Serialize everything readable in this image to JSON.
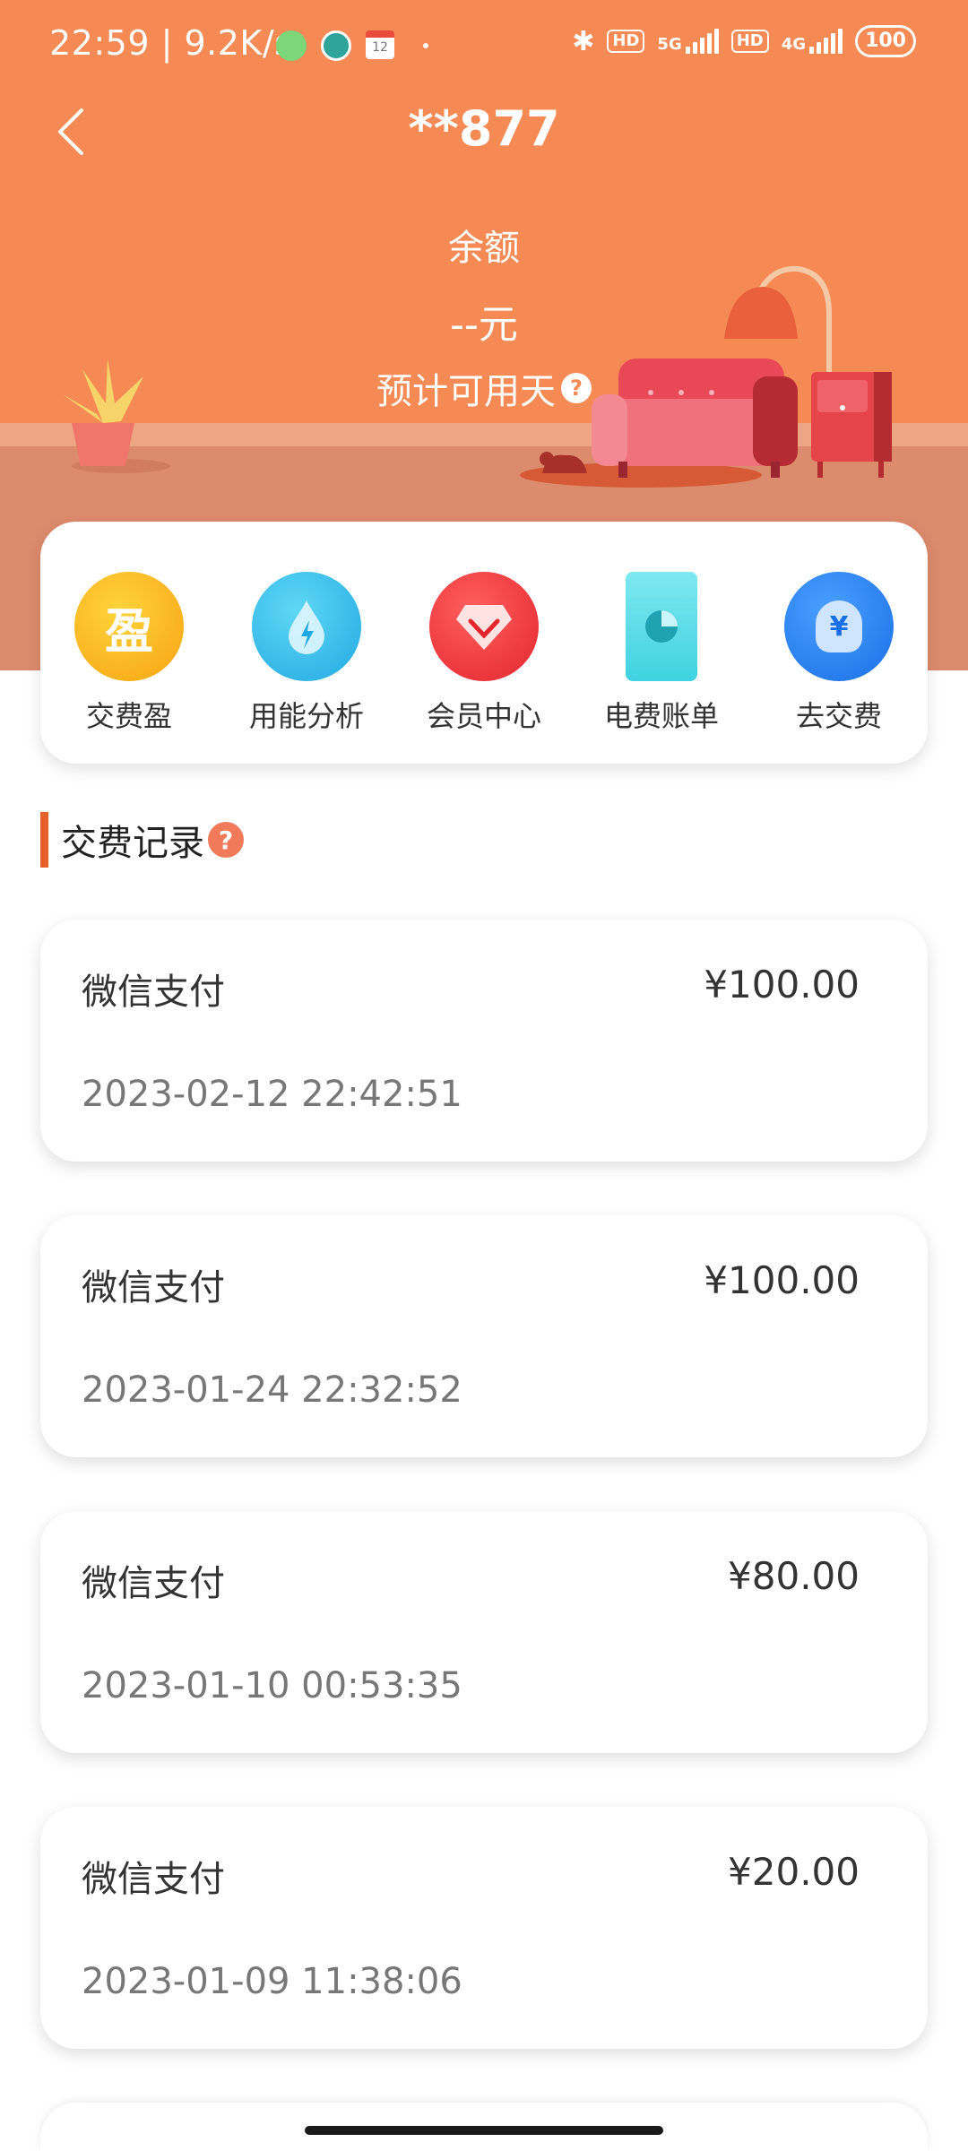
{
  "status_bar": {
    "time": "22:59",
    "speed": "9.2K/s",
    "calendar_day": "12",
    "network_1": "5G",
    "network_2": "4G",
    "hd": "HD",
    "battery": "100"
  },
  "header": {
    "title": "**877",
    "balance_label": "余额",
    "balance_value": "--元",
    "days_label": "预计可用天",
    "help_glyph": "?"
  },
  "actions": [
    {
      "label": "交费盈",
      "icon": "coin-ying-icon",
      "glyph": "盈",
      "color": "#fcb21b"
    },
    {
      "label": "用能分析",
      "icon": "energy-drop-icon",
      "glyph": "",
      "color": "#33c0ec"
    },
    {
      "label": "会员中心",
      "icon": "diamond-icon",
      "glyph": "",
      "color": "#ee3a3a"
    },
    {
      "label": "电费账单",
      "icon": "bill-chart-icon",
      "glyph": "",
      "color": "#3fd2e0"
    },
    {
      "label": "去交费",
      "icon": "pay-bulb-icon",
      "glyph": "¥",
      "color": "#2c7ff0"
    }
  ],
  "section": {
    "title": "交费记录",
    "help_glyph": "?"
  },
  "records": [
    {
      "method": "微信支付",
      "amount": "¥100.00",
      "time": "2023-02-12 22:42:51"
    },
    {
      "method": "微信支付",
      "amount": "¥100.00",
      "time": "2023-01-24 22:32:52"
    },
    {
      "method": "微信支付",
      "amount": "¥80.00",
      "time": "2023-01-10 00:53:35"
    },
    {
      "method": "微信支付",
      "amount": "¥20.00",
      "time": "2023-01-09 11:38:06"
    }
  ],
  "colors": {
    "header_bg": "#f68a55",
    "accent": "#e8602a"
  }
}
